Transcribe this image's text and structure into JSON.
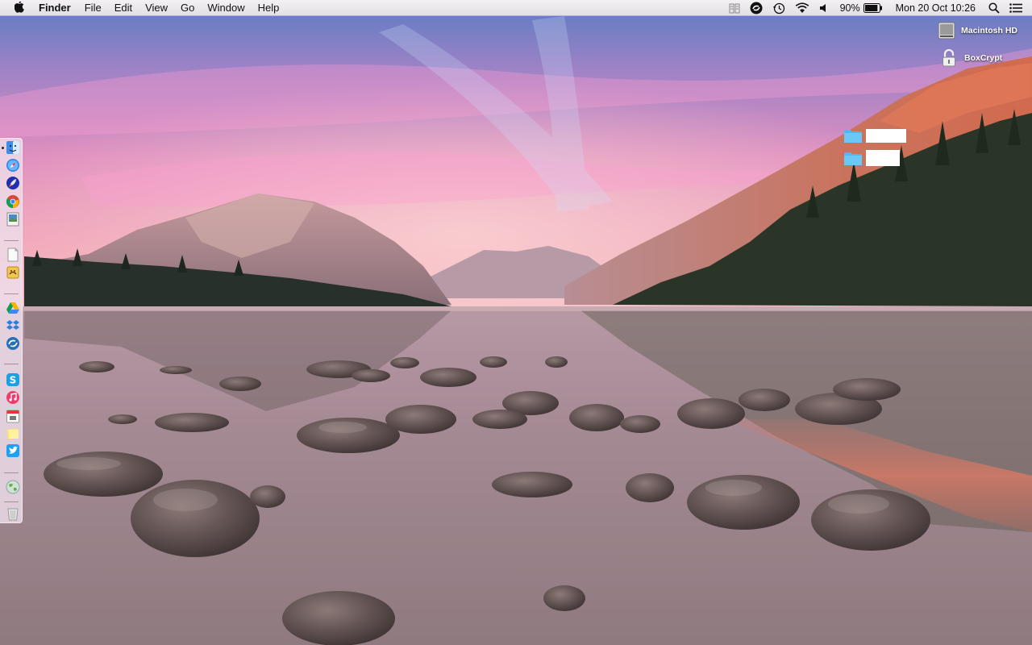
{
  "menubar": {
    "app_name": "Finder",
    "items": [
      "File",
      "Edit",
      "View",
      "Go",
      "Window",
      "Help"
    ],
    "status": {
      "battery_percent": "90%",
      "battery_level": 0.9,
      "clock": "Mon 20 Oct  10:26"
    }
  },
  "desktop": {
    "drives": [
      {
        "label": "Macintosh HD",
        "icon": "hard-drive-icon"
      },
      {
        "label": "BoxCrypt",
        "icon": "padlock-icon"
      }
    ],
    "folders": [
      {
        "label": "",
        "icon": "folder-icon"
      },
      {
        "label": "",
        "icon": "folder-icon"
      }
    ]
  },
  "dock": {
    "apps": [
      {
        "icon": "finder-icon",
        "running": true
      },
      {
        "icon": "safari-icon"
      },
      {
        "icon": "launchpad-rocket-icon"
      },
      {
        "icon": "chrome-icon"
      },
      {
        "icon": "preview-icon"
      },
      {
        "icon": "textedit-icon"
      },
      {
        "icon": "folder-app-icon"
      },
      {
        "icon": "google-drive-icon"
      },
      {
        "icon": "dropbox-icon"
      },
      {
        "icon": "sync-globe-icon"
      },
      {
        "icon": "skype-icon"
      },
      {
        "icon": "itunes-icon"
      },
      {
        "icon": "calendar-icon"
      },
      {
        "icon": "stickies-icon"
      },
      {
        "icon": "twitter-icon"
      },
      {
        "icon": "globe-icon"
      },
      {
        "icon": "trash-icon"
      }
    ]
  },
  "colors": {
    "folder_blue": "#4fb8ee",
    "sky_top": "#5d7fc4",
    "sky_pink": "#e58ab8",
    "water": "#a98a96"
  }
}
